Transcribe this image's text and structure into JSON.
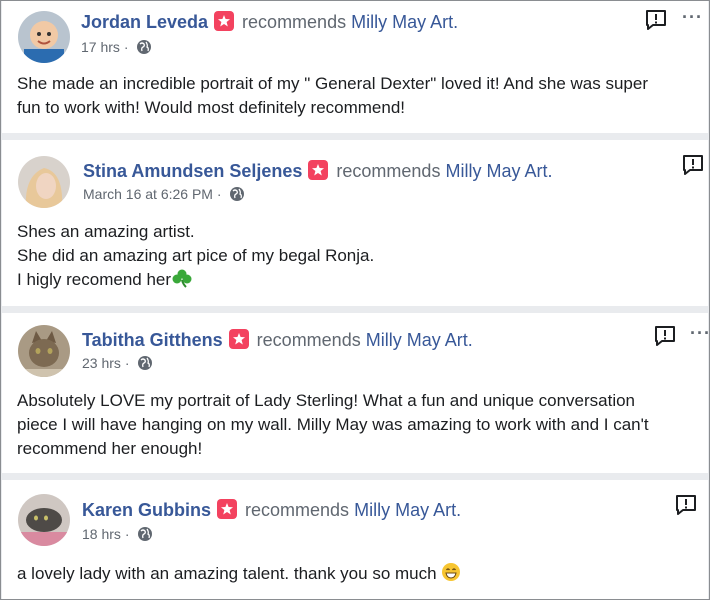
{
  "recommends_text": "recommends",
  "page_name": "Milly May Art.",
  "posts": [
    {
      "author": "Jordan Leveda",
      "time": "17 hrs",
      "body_lines": [
        "She made an incredible portrait of my \" General Dexter\" loved it! And she was super",
        "fun to work with! Would most definitely recommend!"
      ]
    },
    {
      "author": "Stina Amundsen Seljenes",
      "time": "March 16 at 6:26 PM",
      "body_lines": [
        "Shes an amazing artist.",
        "She did an amazing art pice of my begal Ronja.",
        "I higly recomend her"
      ]
    },
    {
      "author": "Tabitha Gitthens",
      "time": "23 hrs",
      "body_lines": [
        "Absolutely LOVE my portrait of Lady Sterling! What a fun and unique conversation",
        "piece I will have hanging on my wall. Milly May was amazing to work with and I can't",
        "recommend her enough!"
      ]
    },
    {
      "author": "Karen Gubbins",
      "time": "18 hrs",
      "body_lines": [
        "a lovely lady with an amazing talent. thank you so much"
      ]
    }
  ],
  "meta_separator": "·",
  "more_label": "···",
  "colors": {
    "link": "#385898",
    "badge": "#f3425f",
    "text": "#1c1e21",
    "muted": "#606770"
  }
}
